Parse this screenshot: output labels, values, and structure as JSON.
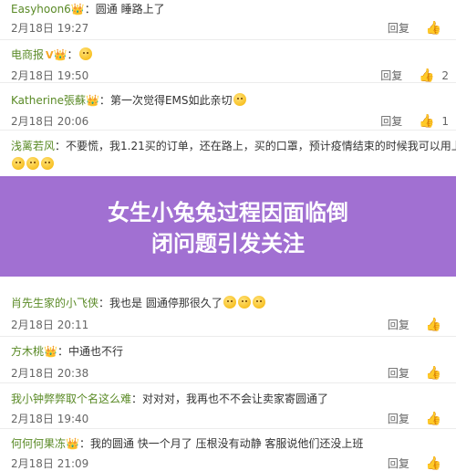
{
  "comments": [
    {
      "user": "Easyhoon6",
      "separator": "：",
      "text": "圆通 睡路上了",
      "date": "2月18日 19:27",
      "reply_label": "回复",
      "like_count": ""
    },
    {
      "user": "电商报",
      "separator": "：",
      "text": "",
      "date": "2月18日 19:50",
      "reply_label": "回复",
      "like_count": "2"
    },
    {
      "user": "Katherine張蘇",
      "separator": "：",
      "text": "第一次觉得EMS如此亲切",
      "date": "2月18日 20:06",
      "reply_label": "回复",
      "like_count": "1"
    },
    {
      "user": "浅蓠若风",
      "separator": "：",
      "text": "不要慌，我1.21买的订单，还在路上，买的口罩，预计疫情结束的时候我可以用上",
      "date": "2月18日 20:06",
      "reply_label": "回复",
      "like_count": "27"
    },
    {
      "user": "肖先生家的小飞侠",
      "separator": "：",
      "text": "我也是 圆通停那很久了",
      "date": "2月18日 20:11",
      "reply_label": "回复",
      "like_count": ""
    },
    {
      "user": "方木桃",
      "separator": "：",
      "text": "中通也不行",
      "date": "2月18日 20:38",
      "reply_label": "回复",
      "like_count": ""
    },
    {
      "user": "我小钟弊弊取个名这么难",
      "separator": "：",
      "text": "对对对，我再也不不会让卖家寄圆通了",
      "date": "2月18日 19:40",
      "reply_label": "回复",
      "like_count": ""
    },
    {
      "user": "何何何果冻",
      "separator": "：",
      "text": "我的圆通 快一个月了 压根没有动静 客服说他们还没上班",
      "date": "2月18日 21:09",
      "reply_label": "回复",
      "like_count": ""
    }
  ],
  "overlay": {
    "title_line1": "女生小兔兔过程因面临倒",
    "title_line2": "闭问题引发关注"
  },
  "icons": {
    "like": "thumbs-up-icon",
    "verified": "verified-v-icon",
    "emoji": "smiley-emoji-icon",
    "vip": "vip-crown-icon"
  },
  "colors": {
    "username": "#5a8a26",
    "overlay": "#8c50c8",
    "verified": "#f5a623"
  }
}
